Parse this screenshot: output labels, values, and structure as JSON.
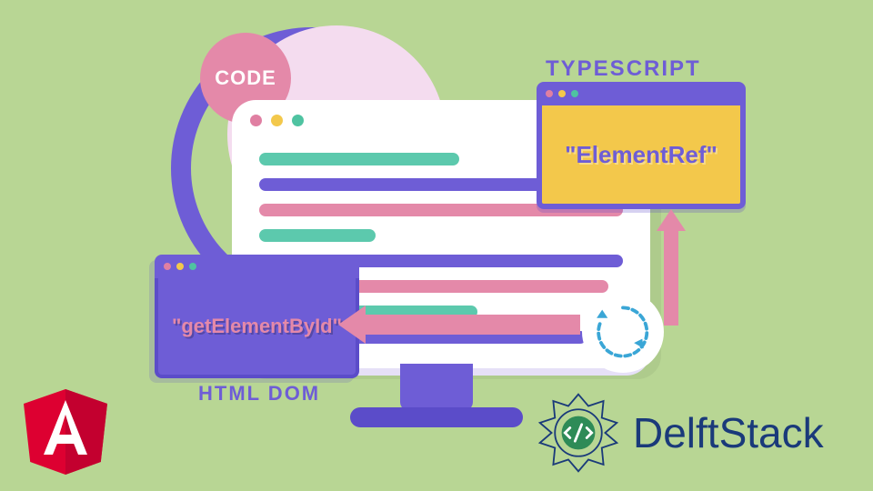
{
  "badge": {
    "code": "CODE"
  },
  "labels": {
    "typescript": "TYPESCRIPT",
    "html_dom": "HTML DOM"
  },
  "panels": {
    "typescript_body": "\"ElementRef\"",
    "dom_body": "\"getElementById\""
  },
  "brand": {
    "name": "DelftStack"
  },
  "colors": {
    "bg": "#b8d694",
    "purple": "#6e5dd6",
    "pink": "#e489a9",
    "teal": "#5cc9ad",
    "yellow": "#f3c84b",
    "angular_red": "#dd0031",
    "delft_blue": "#1a3a7a"
  }
}
